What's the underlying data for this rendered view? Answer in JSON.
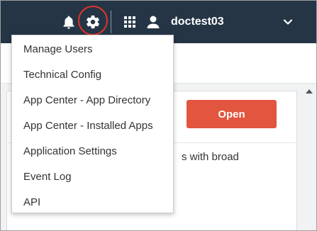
{
  "header": {
    "username": "doctest03",
    "icons": [
      "bell-icon",
      "gear-icon",
      "apps-grid-icon",
      "user-icon",
      "chevron-down-icon"
    ],
    "background_color": "#253546",
    "highlight_ring_color": "#e0342c"
  },
  "settings_menu": {
    "items": [
      {
        "label": "Manage Users"
      },
      {
        "label": "Technical Config"
      },
      {
        "label": "App Center - App Directory"
      },
      {
        "label": "App Center - Installed Apps"
      },
      {
        "label": "Application Settings"
      },
      {
        "label": "Event Log"
      },
      {
        "label": "API"
      }
    ]
  },
  "card": {
    "open_button_label": "Open",
    "open_button_color": "#e2553e",
    "description_fragment": "s with broad"
  }
}
